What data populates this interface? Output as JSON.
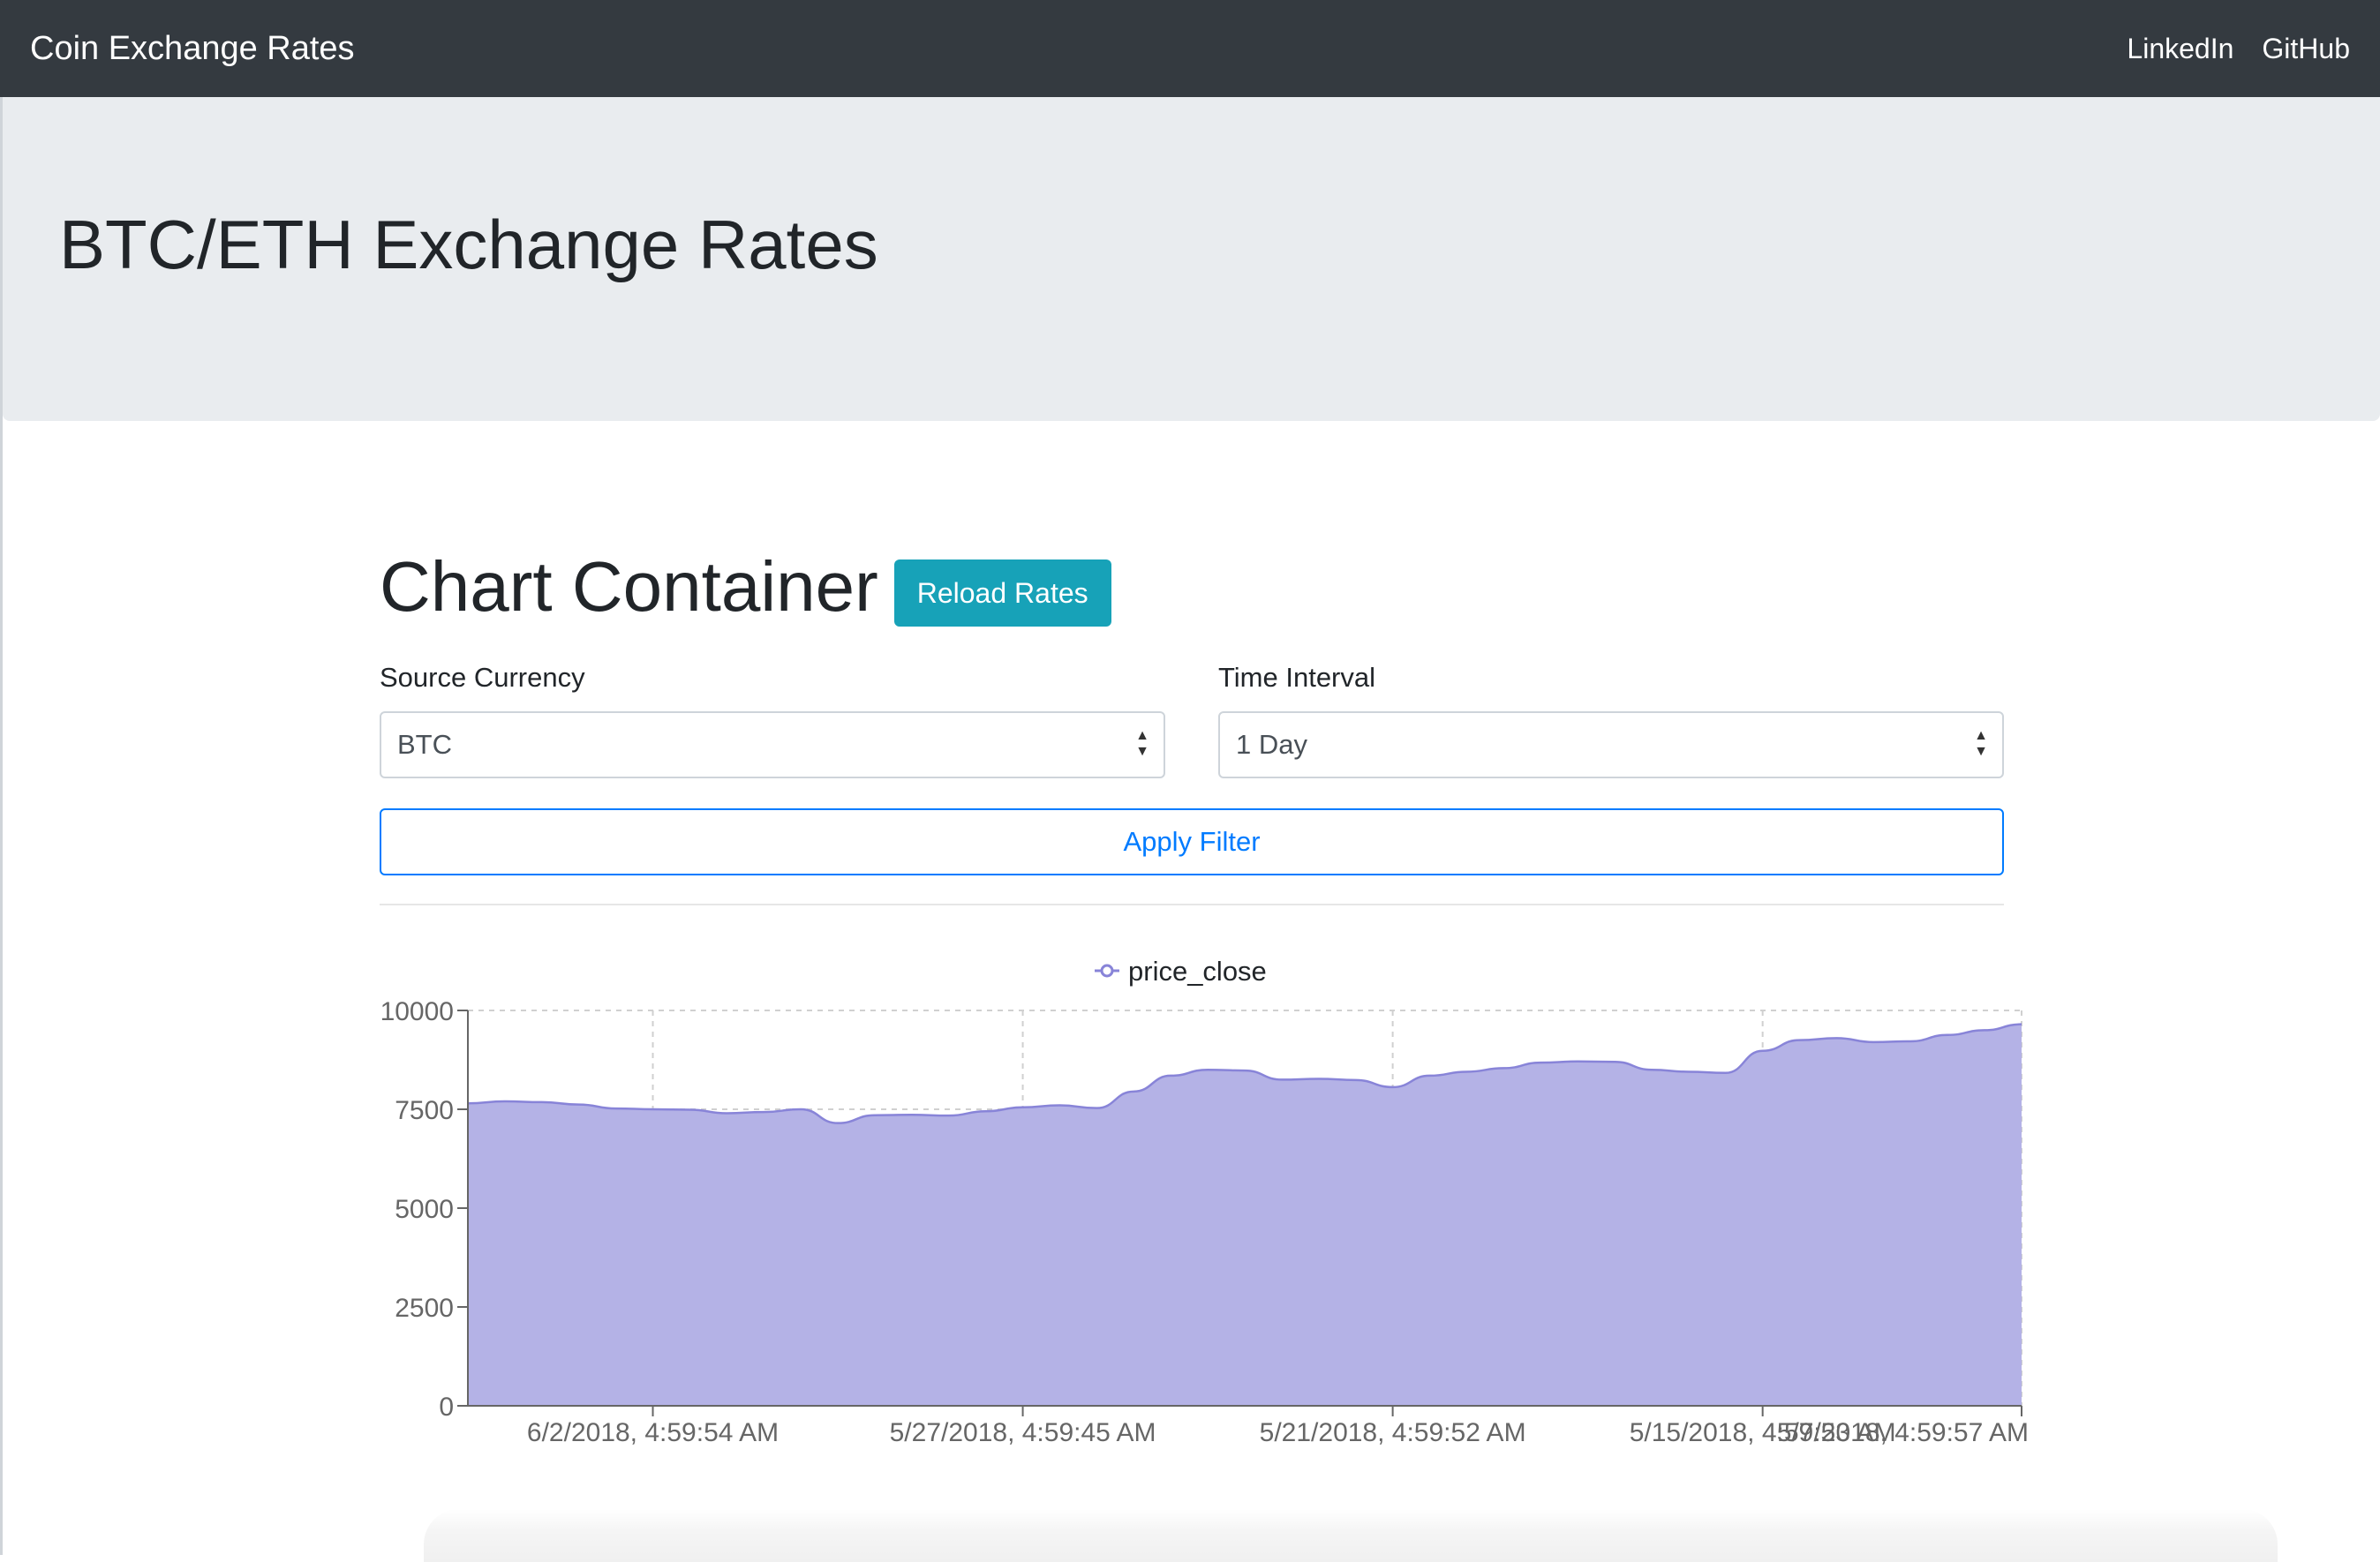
{
  "navbar": {
    "brand": "Coin Exchange Rates",
    "links": [
      "LinkedIn",
      "GitHub"
    ]
  },
  "jumbotron": {
    "title": "BTC/ETH Exchange Rates"
  },
  "chart_section": {
    "title": "Chart Container",
    "reload_label": "Reload Rates",
    "source_label": "Source Currency",
    "source_value": "BTC",
    "interval_label": "Time Interval",
    "interval_value": "1 Day",
    "apply_label": "Apply Filter"
  },
  "colors": {
    "navbar": "#343a40",
    "jumbotron": "#e9ecef",
    "reload_button": "#17a2b8",
    "primary": "#007bff",
    "area_fill": "#b4b2e6",
    "area_stroke": "#8884d8"
  },
  "chart_data": {
    "type": "area",
    "legend": "price_close",
    "legend_position": "top-center",
    "grid": true,
    "ylim": [
      0,
      10000
    ],
    "yticks": [
      0,
      2500,
      5000,
      7500,
      10000
    ],
    "xtick_labels": [
      "6/2/2018, 4:59:54 AM",
      "5/27/2018, 4:59:45 AM",
      "5/21/2018, 4:59:52 AM",
      "5/15/2018, 4:59:53 AM",
      "5/7/2018, 4:59:57 AM"
    ],
    "series": [
      {
        "name": "price_close",
        "values": [
          7650,
          7700,
          7680,
          7620,
          7520,
          7500,
          7490,
          7400,
          7430,
          7500,
          7150,
          7350,
          7360,
          7340,
          7450,
          7550,
          7600,
          7530,
          7950,
          8350,
          8500,
          8480,
          8250,
          8270,
          8240,
          8060,
          8350,
          8450,
          8540,
          8680,
          8710,
          8700,
          8500,
          8450,
          8420,
          8980,
          9250,
          9300,
          9200,
          9220,
          9380,
          9500,
          9650
        ]
      }
    ]
  }
}
